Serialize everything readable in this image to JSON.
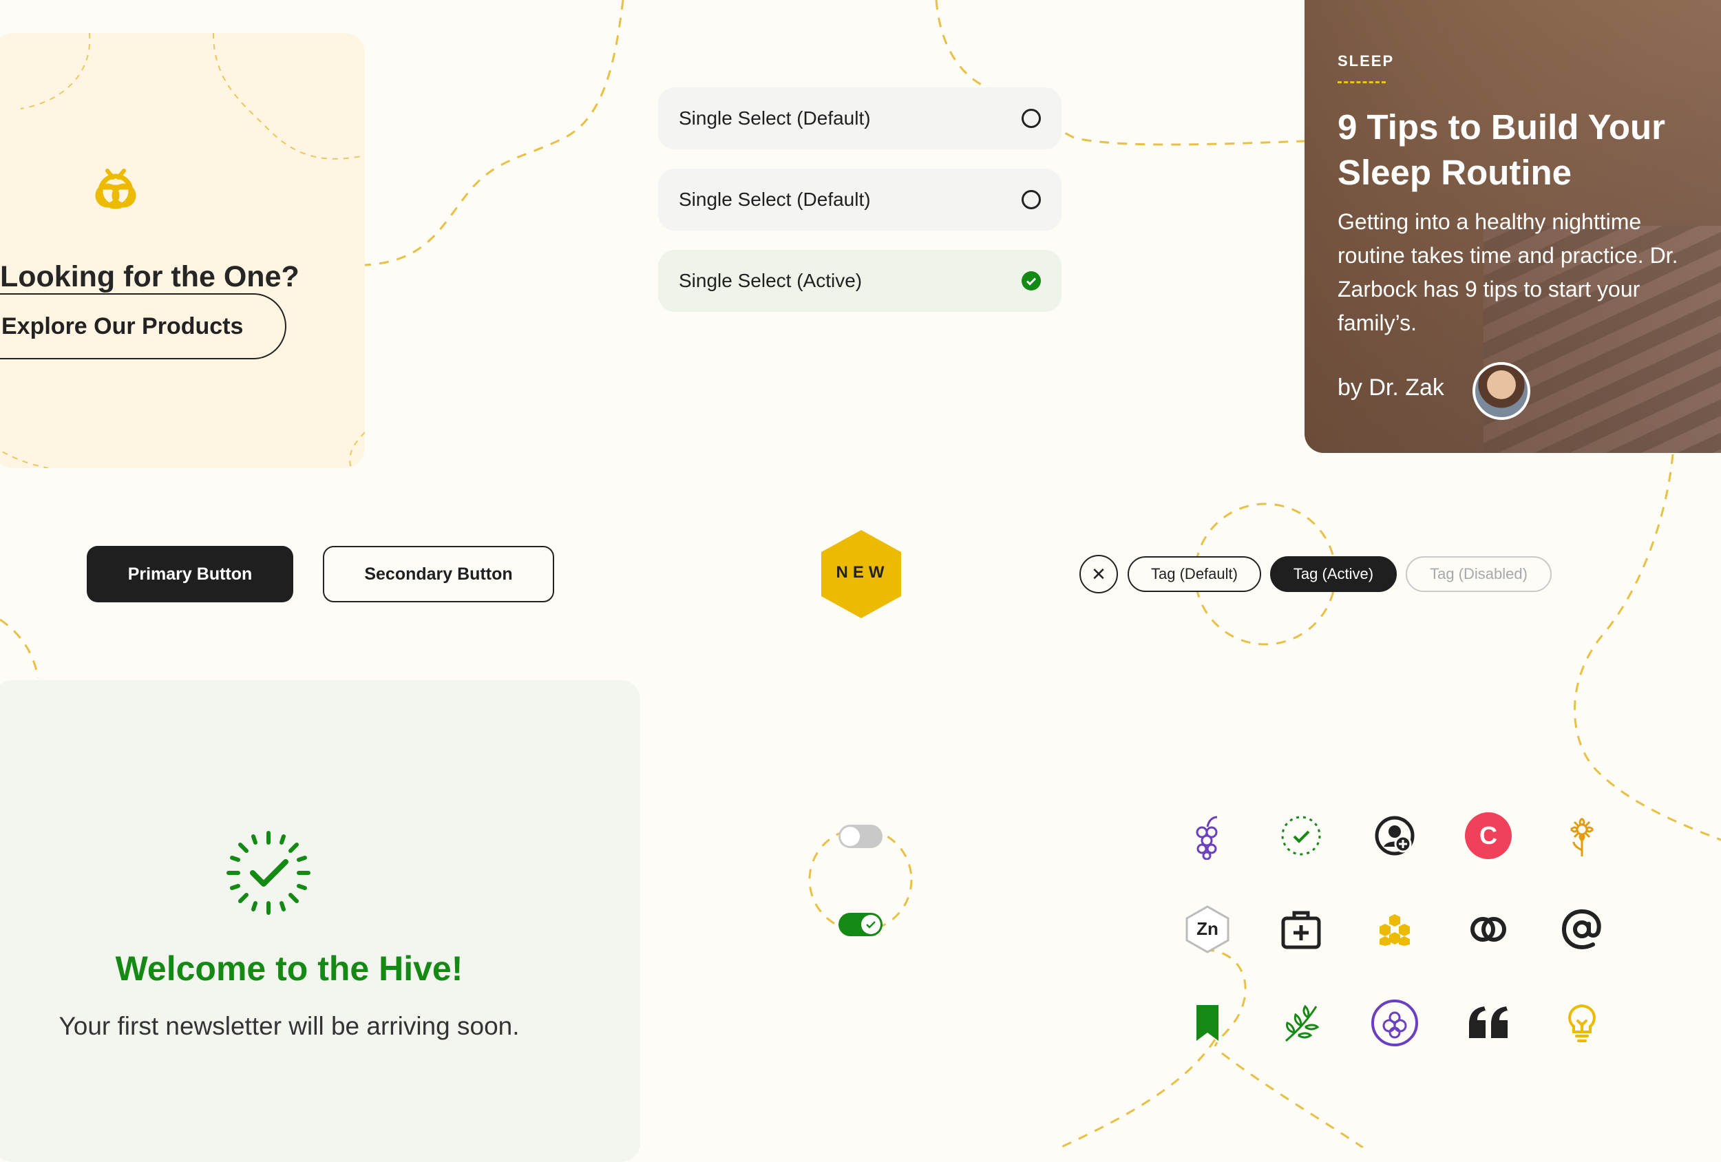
{
  "promo": {
    "title": "Looking for the One?",
    "button": "Explore Our Products"
  },
  "selects": [
    {
      "label": "Single Select (Default)",
      "state": "default"
    },
    {
      "label": "Single Select (Default)",
      "state": "default"
    },
    {
      "label": "Single Select (Active)",
      "state": "active"
    }
  ],
  "article": {
    "category": "SLEEP",
    "title": "9 Tips to Build Your Sleep Routine",
    "description": "Getting into a healthy nighttime routine takes time and practice. Dr. Zarbock has 9 tips to start your family’s.",
    "byline": "by Dr. Zak"
  },
  "buttons": {
    "primary": "Primary Button",
    "secondary": "Secondary Button"
  },
  "badge": {
    "text": "NEW"
  },
  "tags": {
    "default": "Tag (Default)",
    "active": "Tag (Active)",
    "disabled": "Tag (Disabled)"
  },
  "welcome": {
    "title": "Welcome to the Hive!",
    "message": "Your first newsletter will be arriving soon."
  },
  "toggles": [
    {
      "state": "off"
    },
    {
      "state": "on"
    }
  ],
  "icons": {
    "row1": [
      "grapes-icon",
      "dashed-check-circle-icon",
      "profile-add-icon",
      "letter-c-circle-icon",
      "flower-icon"
    ],
    "row2": [
      "zinc-hexagon-icon",
      "first-aid-kit-icon",
      "honeycomb-icon",
      "overlapping-rings-icon",
      "at-sign-icon"
    ],
    "row3": [
      "bookmark-icon",
      "herb-leaf-icon",
      "berries-circle-icon",
      "quote-icon",
      "lightbulb-icon"
    ],
    "c_letter": "C",
    "zinc_label": "Zn"
  },
  "colors": {
    "background": "#fdfcf7",
    "brand_yellow": "#ecba00",
    "success_green": "#148a14",
    "primary_dark": "#1f1f1f",
    "purple": "#6a3fc0",
    "coral": "#f0405a"
  }
}
